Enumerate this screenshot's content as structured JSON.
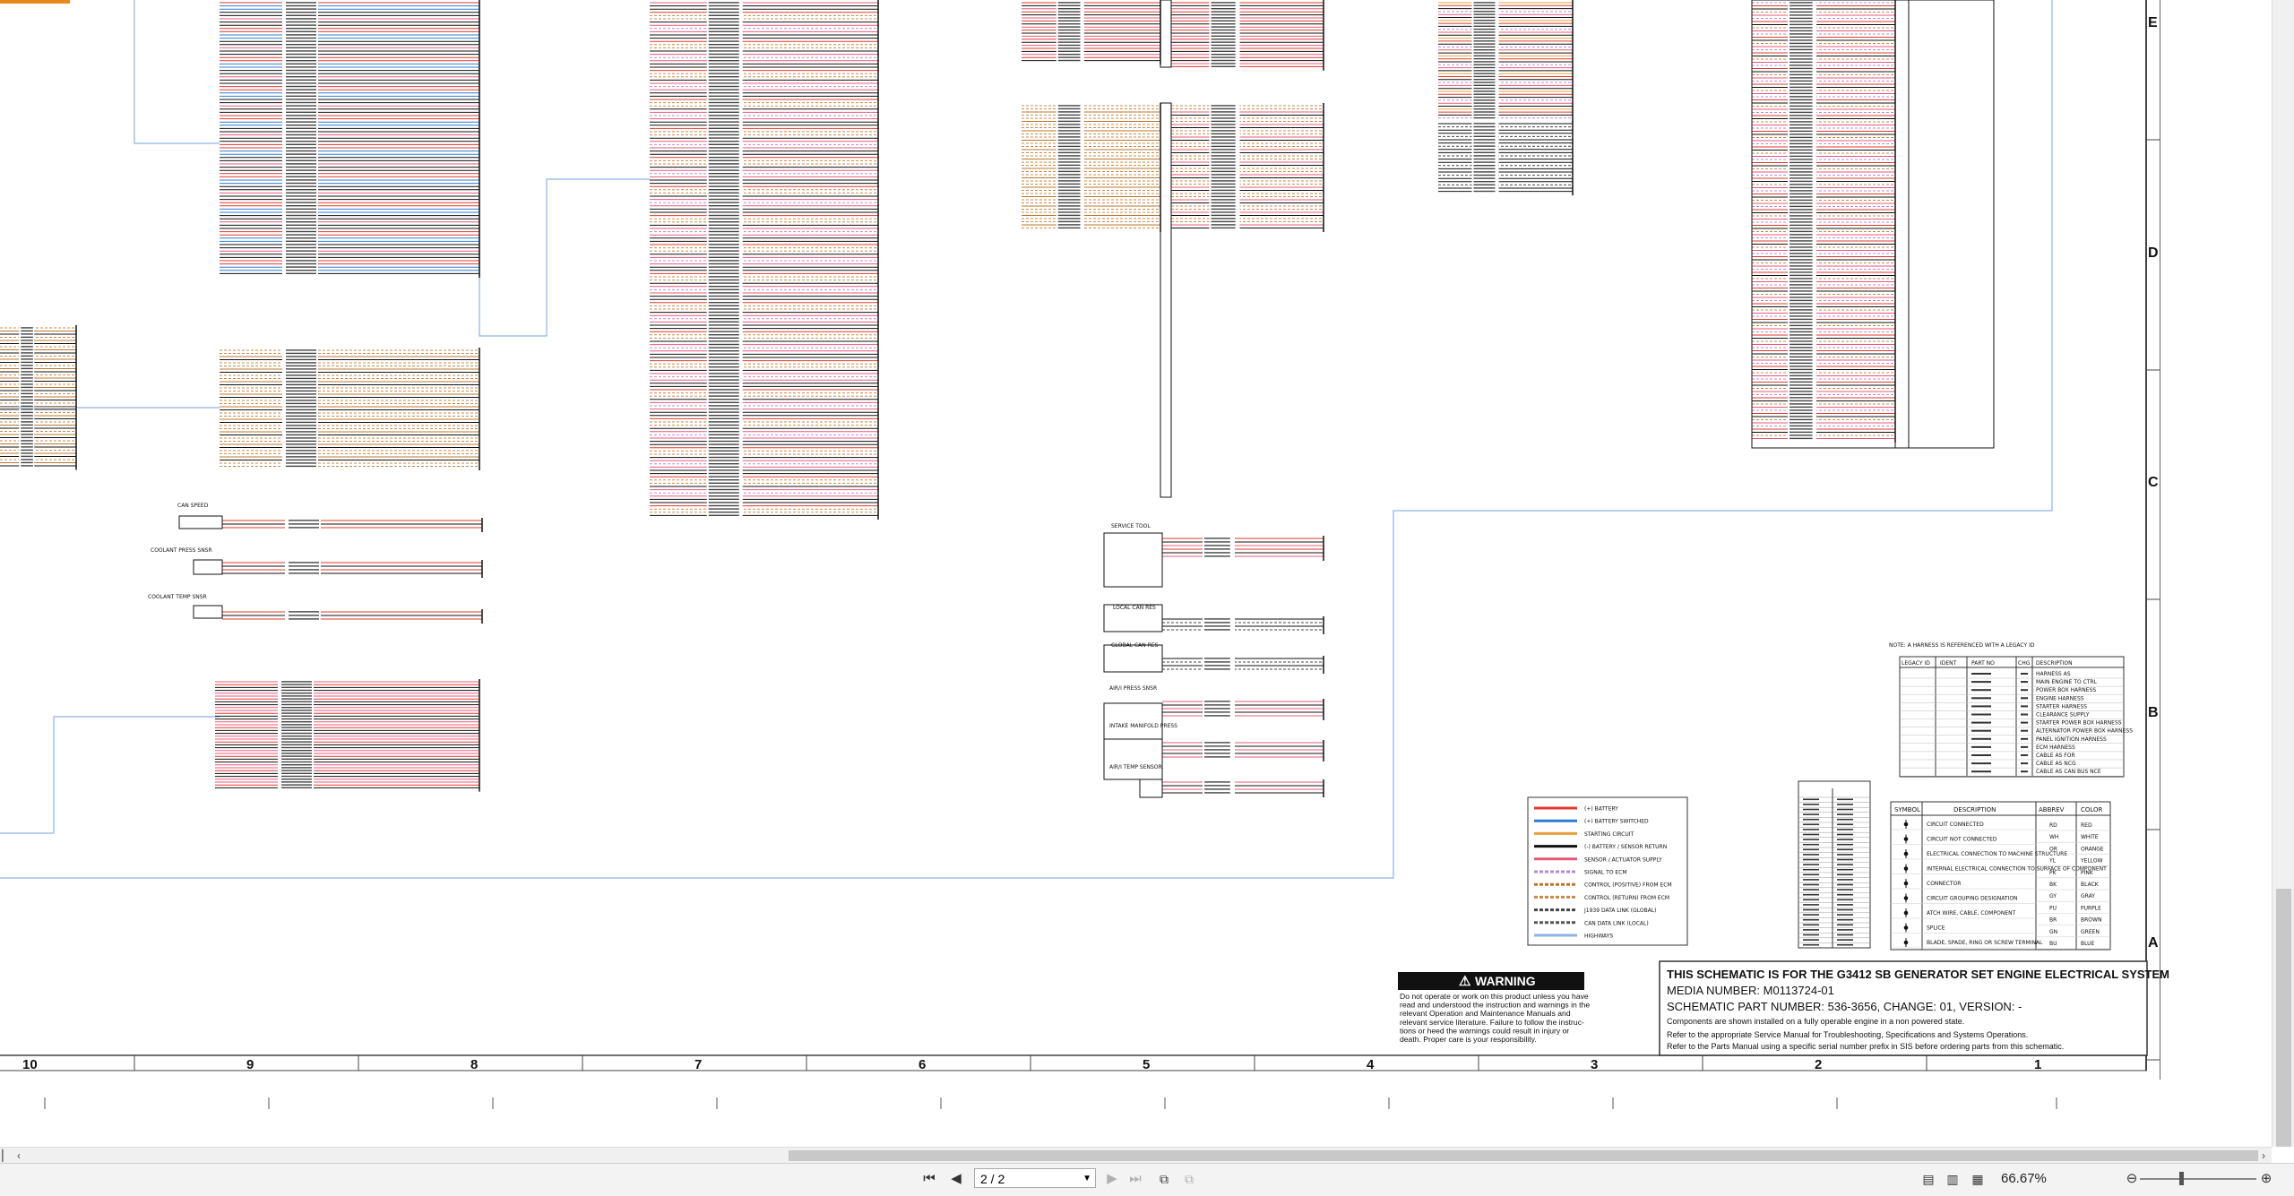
{
  "document": {
    "title_block": {
      "line1": "THIS SCHEMATIC IS FOR THE G3412 SB GENERATOR SET ENGINE ELECTRICAL SYSTEM",
      "line2": "MEDIA NUMBER: M0113724-01",
      "line3": "SCHEMATIC PART NUMBER: 536-3656, CHANGE: 01, VERSION: -",
      "line4": "Components are shown installed on a fully operable engine in a non powered state.",
      "line5": "Refer to the appropriate Service Manual for Troubleshooting, Specifications and Systems Operations.",
      "line6": "Refer to the Parts Manual using a specific serial number prefix in SIS before ordering parts from this schematic."
    },
    "warning": {
      "title": "WARNING",
      "text_lines": [
        "Do not operate or work on this product unless you have",
        "read and understood the instruction and warnings in the",
        "relevant Operation and Maintenance Manuals and",
        "relevant service literature. Failure to follow the instruc-",
        "tions or heed the warnings could result in injury or",
        "death. Proper care is your responsibility."
      ]
    },
    "column_numbers": [
      "10",
      "9",
      "8",
      "7",
      "6",
      "5",
      "4",
      "3",
      "2",
      "1"
    ],
    "zone_letters": [
      "E",
      "D",
      "C",
      "B",
      "A"
    ],
    "line_legend": [
      {
        "label": "(+) BATTERY",
        "color": "#e0392b"
      },
      {
        "label": "(+) BATTERY SWITCHED",
        "color": "#2a7fd4"
      },
      {
        "label": "STARTING CIRCUIT",
        "color": "#e8a13a"
      },
      {
        "label": "(-) BATTERY / SENSOR RETURN",
        "color": "#111111"
      },
      {
        "label": "SENSOR / ACTUATOR SUPPLY",
        "color": "#e8587a"
      },
      {
        "label": "SIGNAL TO ECM",
        "color": "#b68ad8"
      },
      {
        "label": "CONTROL (POSITIVE) FROM ECM",
        "color": "#b9772e"
      },
      {
        "label": "CONTROL (RETURN) FROM ECM",
        "color": "#c98a4a"
      },
      {
        "label": "J1939 DATA LINK (GLOBAL)",
        "color": "#444444"
      },
      {
        "label": "CAN DATA LINK (LOCAL)",
        "color": "#555555"
      },
      {
        "label": "HIGHWAYS",
        "color": "#8db3e2"
      }
    ],
    "symbol_table": {
      "headers": [
        "SYMBOL",
        "DESCRIPTION",
        "ABBREV",
        "COLOR"
      ],
      "descriptions": [
        "CIRCUIT CONNECTED",
        "CIRCUIT NOT CONNECTED",
        "ELECTRICAL CONNECTION TO MACHINE STRUCTURE",
        "INTERNAL ELECTRICAL CONNECTION TO SURFACE OF COMPONENT",
        "CONNECTOR",
        "CIRCUIT GROUPING DESIGNATION",
        "ATCH WIRE, CABLE, COMPONENT",
        "SPLICE",
        "BLADE, SPADE, RING OR SCREW TERMINAL"
      ],
      "abbrevs": [
        "RD",
        "WH",
        "OR",
        "YL",
        "PK",
        "BK",
        "GY",
        "PU",
        "BR",
        "GN",
        "BU"
      ],
      "colors": [
        "RED",
        "WHITE",
        "ORANGE",
        "YELLOW",
        "PINK",
        "BLACK",
        "GRAY",
        "PURPLE",
        "BROWN",
        "GREEN",
        "BLUE"
      ]
    },
    "harness_table": {
      "note": "NOTE: A HARNESS IS REFERENCED WITH A LEGACY ID",
      "headers": [
        "LEGACY ID",
        "IDENT",
        "PART NO",
        "CHG",
        "DESCRIPTION"
      ],
      "descriptions": [
        "HARNESS AS",
        "MAIN ENGINE TO CTRL",
        "POWER BOX HARNESS",
        "ENGINE HARNESS",
        "STARTER HARNESS",
        "CLEARANCE SUPPLY",
        "STARTER POWER BOX HARNESS",
        "ALTERNATOR POWER BOX HARNESS",
        "PANEL IGNITION HARNESS",
        "ECM HARNESS",
        "CABLE AS FOR",
        "CABLE AS NCG",
        "CABLE AS CAN BUS NCE"
      ]
    },
    "components": [
      "CAN SPEED",
      "COOLANT PRESS SNSR",
      "COOLANT TEMP SNSR",
      "SERVICE TOOL",
      "LOCAL CAN RES",
      "GLOBAL CAN RES",
      "AIR/I PRESS SNSR",
      "INTAKE MANIFOLD PRESS",
      "AIR/I TEMP SENSOR"
    ]
  },
  "viewer": {
    "page_indicator": "2 / 2",
    "zoom": "66.67%",
    "buttons": {
      "first_page": "first-page",
      "prev_page": "prev-page",
      "next_page": "next-page",
      "last_page": "last-page"
    }
  }
}
